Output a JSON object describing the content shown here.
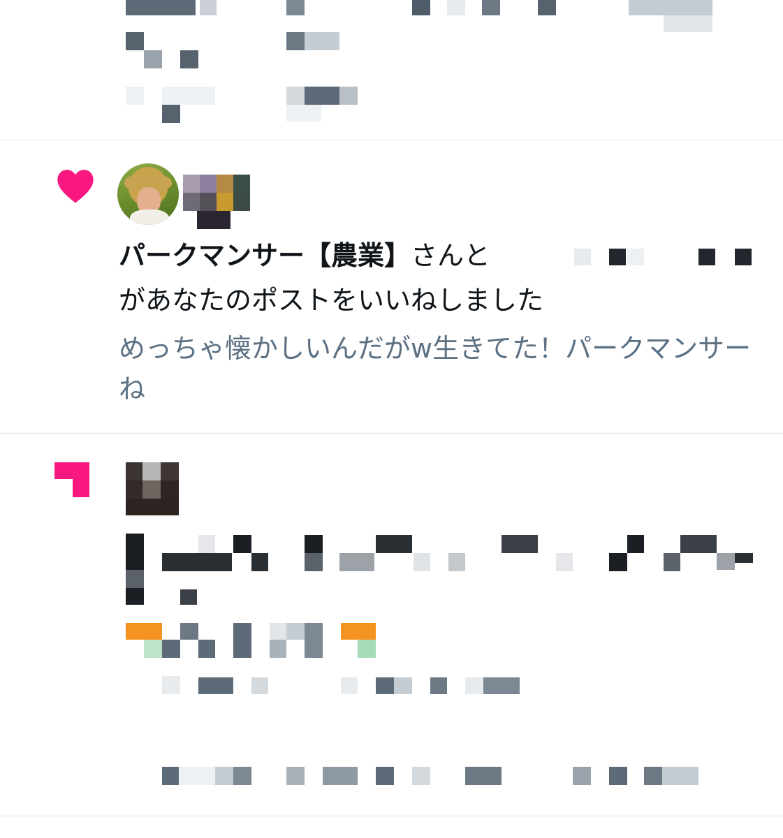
{
  "notifications": [
    {
      "type": "hidden",
      "content_redacted": true
    },
    {
      "type": "like",
      "icon": "heart-icon",
      "actor_name": "パークマンサー【農業】",
      "actor_suffix": "さんと",
      "message": "があなたのポストをいいねしました",
      "post_preview": "めっちゃ懐かしいんだがw生きてた！パークマンサーね"
    },
    {
      "type": "hidden",
      "icon": "pink-corner-icon",
      "content_redacted": true
    }
  ],
  "colors": {
    "heart": "#f91880",
    "text_primary": "#0f1419",
    "text_secondary": "#5b7083",
    "divider": "#e3e7ea"
  }
}
